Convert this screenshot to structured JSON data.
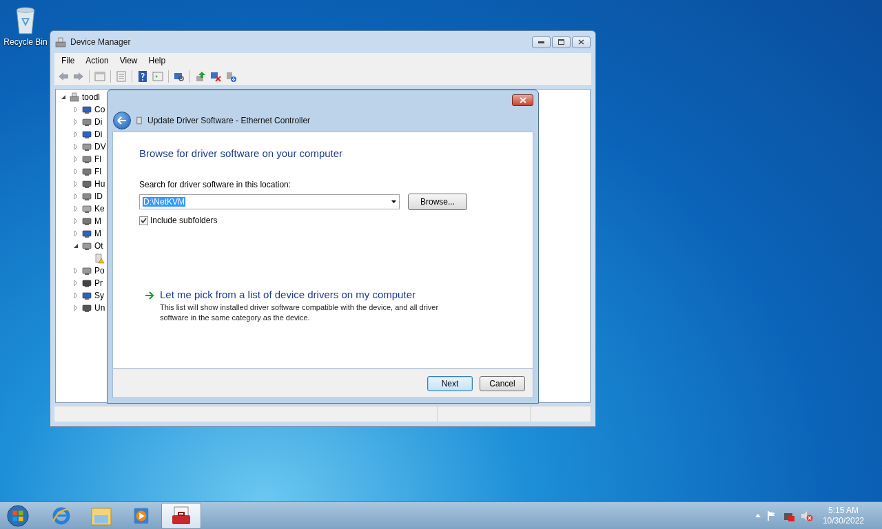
{
  "desktop_icons": [
    {
      "label": "Recycle Bin"
    }
  ],
  "device_manager": {
    "title": "Device Manager",
    "menu": [
      "File",
      "Action",
      "View",
      "Help"
    ],
    "tree": {
      "label": "toodl",
      "expanded": true,
      "children": [
        {
          "label": "Co",
          "expanded": false
        },
        {
          "label": "Di",
          "expanded": false
        },
        {
          "label": "Di",
          "expanded": false
        },
        {
          "label": "DV",
          "expanded": false
        },
        {
          "label": "Fl",
          "expanded": false
        },
        {
          "label": "Fl",
          "expanded": false
        },
        {
          "label": "Hu",
          "expanded": false
        },
        {
          "label": "ID",
          "expanded": false
        },
        {
          "label": "Ke",
          "expanded": false
        },
        {
          "label": "M",
          "expanded": false
        },
        {
          "label": "M",
          "expanded": false
        },
        {
          "label": "Ot",
          "expanded": true,
          "children": [
            {
              "warning": true
            }
          ]
        },
        {
          "label": "Po",
          "expanded": false
        },
        {
          "label": "Pr",
          "expanded": false
        },
        {
          "label": "Sy",
          "expanded": false
        },
        {
          "label": "Un",
          "expanded": false
        }
      ]
    }
  },
  "dialog": {
    "title": "Update Driver Software - Ethernet Controller",
    "heading": "Browse for driver software on your computer",
    "location_label": "Search for driver software in this location:",
    "location_value": "D:\\NetKVM",
    "browse_button": "Browse...",
    "include_subfolders": {
      "label": "Include subfolders",
      "checked": true
    },
    "pick_link": {
      "title": "Let me pick from a list of device drivers on my computer",
      "description": "This list will show installed driver software compatible with the device, and all driver software in the same category as the device."
    },
    "buttons": [
      {
        "label": "Next",
        "default": true
      },
      {
        "label": "Cancel",
        "default": false
      }
    ]
  },
  "taskbar": {
    "items": [
      {
        "kind": "ie",
        "selected": false
      },
      {
        "kind": "explorer",
        "selected": false
      },
      {
        "kind": "media",
        "selected": false
      },
      {
        "kind": "toolbox",
        "selected": true
      }
    ],
    "clock": {
      "time": "5:15 AM",
      "date": "10/30/2022"
    }
  }
}
